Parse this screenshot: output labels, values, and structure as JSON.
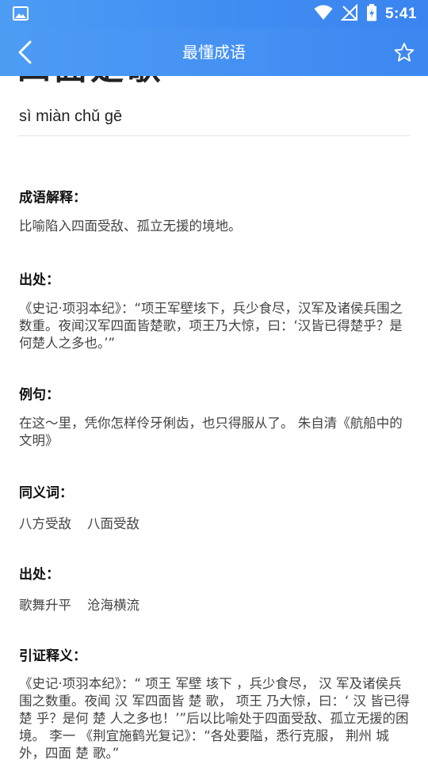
{
  "status": {
    "time": "5:41"
  },
  "header": {
    "title": "最懂成语"
  },
  "idiom": {
    "title_cut": "四面楚歌",
    "pinyin": "sì miàn chǔ gē"
  },
  "sections": {
    "meaning": {
      "label": "成语解释：",
      "text": " 比喻陷入四面受敌、孤立无援的境地。"
    },
    "source": {
      "label": "出处：",
      "text": " 《史记·项羽本纪》：“项王军壁垓下，兵少食尽，汉军及诸侯兵围之数重。夜闻汉军四面皆楚歌，项王乃大惊，曰：‘汉皆已得楚乎？是何楚人之多也。’”"
    },
    "example": {
      "label": "例句：",
      "text": " 在这～里，凭你怎样伶牙俐齿，也只得服从了。 朱自清《航船中的文明》"
    },
    "synonyms": {
      "label": "同义词：",
      "items": [
        "八方受敌",
        "八面受敌"
      ]
    },
    "antonyms": {
      "label": "出处：",
      "items": [
        "歌舞升平",
        "沧海横流"
      ]
    },
    "citation": {
      "label": "引证释义：",
      "text": "《史记·项羽本纪》：“ 项王 军壁 垓下 ，兵少食尽， 汉 军及诸侯兵围之数重。夜闻 汉 军四面皆 楚 歌， 项王 乃大惊，曰：‘ 汉 皆已得 楚 乎？是何 楚 人之多也！’”后以比喻处于四面受敌、孤立无援的困境。 李一 《荆宜施鹤光复记》：“各处要隘，悉行克服， 荆州 城外，四面 楚 歌。”"
    }
  }
}
